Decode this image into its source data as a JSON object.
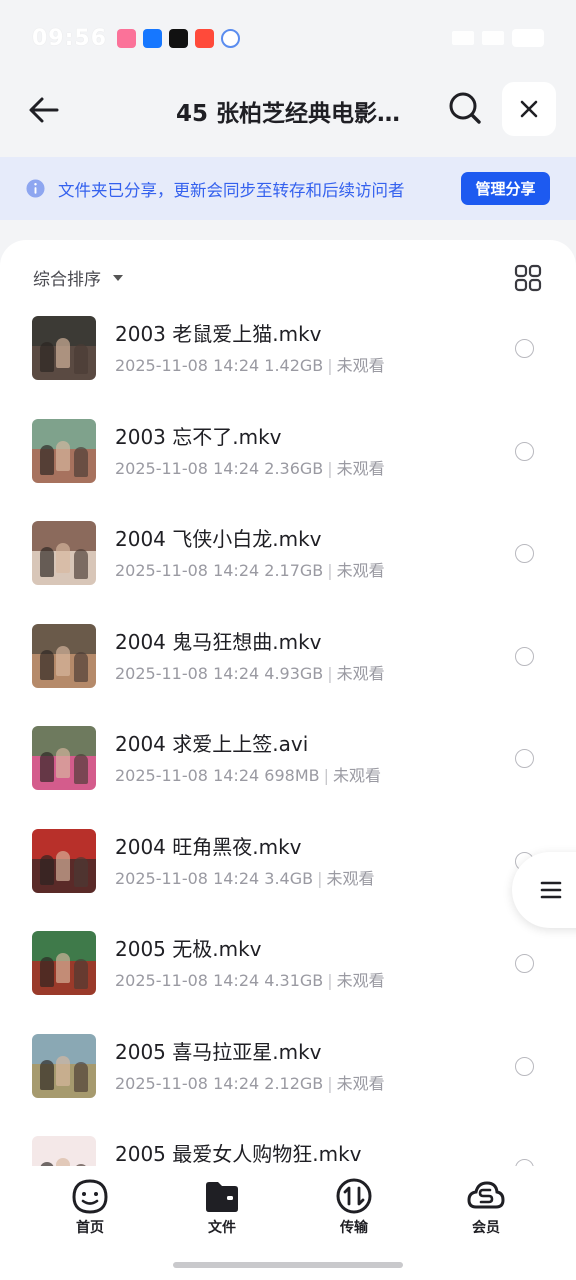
{
  "status_bar": {
    "time": "09:56"
  },
  "header": {
    "title": "45 张柏芝经典电影…"
  },
  "banner": {
    "text": "文件夹已分享，更新会同步至转存和后续访问者",
    "button": "管理分享"
  },
  "sort": {
    "label": "综合排序"
  },
  "files": [
    {
      "name": "2003 老鼠爱上猫.mkv",
      "date": "2025-11-08 14:24",
      "size": "1.42GB",
      "status": "未观看",
      "colors": [
        "#3c3a35",
        "#5a4a42"
      ]
    },
    {
      "name": "2003 忘不了.mkv",
      "date": "2025-11-08 14:24",
      "size": "2.36GB",
      "status": "未观看",
      "colors": [
        "#7fa28c",
        "#a7725e"
      ]
    },
    {
      "name": "2004 飞侠小白龙.mkv",
      "date": "2025-11-08 14:24",
      "size": "2.17GB",
      "status": "未观看",
      "colors": [
        "#8b6a5c",
        "#d8c6b8"
      ]
    },
    {
      "name": "2004 鬼马狂想曲.mkv",
      "date": "2025-11-08 14:24",
      "size": "4.93GB",
      "status": "未观看",
      "colors": [
        "#6a5a4a",
        "#b58a6a"
      ]
    },
    {
      "name": "2004 求爱上上签.avi",
      "date": "2025-11-08 14:24",
      "size": "698MB",
      "status": "未观看",
      "colors": [
        "#6e7a5e",
        "#d45c8c"
      ]
    },
    {
      "name": "2004 旺角黑夜.mkv",
      "date": "2025-11-08 14:24",
      "size": "3.4GB",
      "status": "未观看",
      "colors": [
        "#b8302a",
        "#5a2a28"
      ]
    },
    {
      "name": "2005 无极.mkv",
      "date": "2025-11-08 14:24",
      "size": "4.31GB",
      "status": "未观看",
      "colors": [
        "#3f7a4a",
        "#9a3a2a"
      ]
    },
    {
      "name": "2005 喜马拉亚星.mkv",
      "date": "2025-11-08 14:24",
      "size": "2.12GB",
      "status": "未观看",
      "colors": [
        "#8aa8b4",
        "#a69a6e"
      ]
    },
    {
      "name": "2005 最爱女人购物狂.mkv",
      "date": "2025-11-08 14:24",
      "size": "",
      "status": "",
      "colors": [
        "#f4e8e8",
        "#e04a3a"
      ]
    }
  ],
  "tabs": [
    {
      "label": "首页",
      "icon": "smile-face-icon"
    },
    {
      "label": "文件",
      "icon": "folder-icon"
    },
    {
      "label": "传输",
      "icon": "transfer-icon"
    },
    {
      "label": "会员",
      "icon": "vip-cloud-icon"
    }
  ],
  "colors": {
    "accent": "#1d5af0",
    "banner_bg": "#e6ebfa",
    "banner_text": "#3461ee"
  }
}
